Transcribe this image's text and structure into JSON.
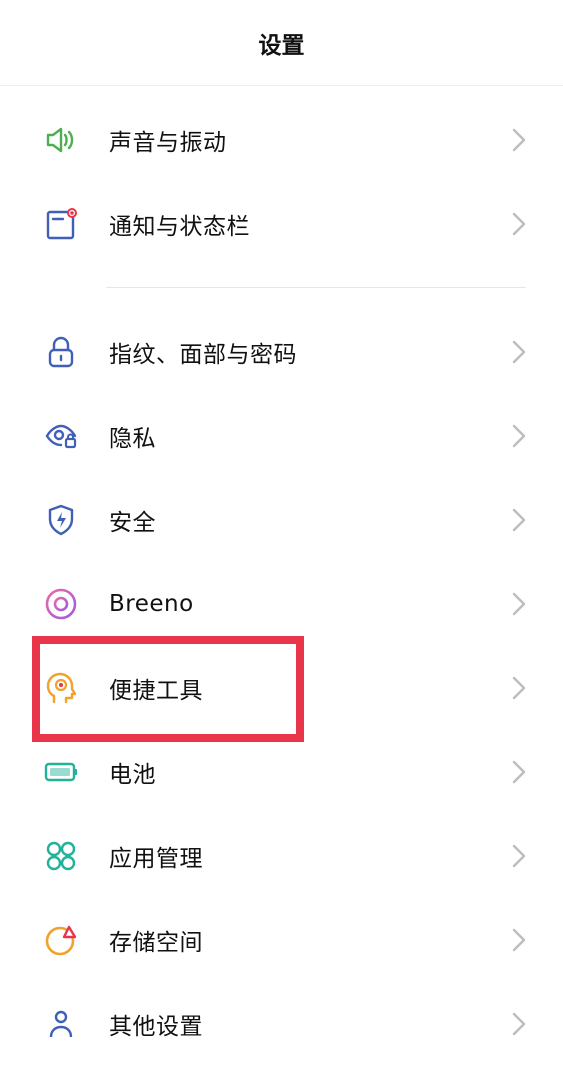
{
  "header": {
    "title": "设置"
  },
  "items": [
    {
      "label": "声音与振动",
      "icon": "speaker-icon"
    },
    {
      "label": "通知与状态栏",
      "icon": "notification-icon"
    },
    {
      "label": "指纹、面部与密码",
      "icon": "lock-icon"
    },
    {
      "label": "隐私",
      "icon": "eye-lock-icon"
    },
    {
      "label": "安全",
      "icon": "shield-icon"
    },
    {
      "label": "Breeno",
      "icon": "breeno-icon"
    },
    {
      "label": "便捷工具",
      "icon": "head-icon"
    },
    {
      "label": "电池",
      "icon": "battery-icon"
    },
    {
      "label": "应用管理",
      "icon": "apps-icon"
    },
    {
      "label": "存储空间",
      "icon": "storage-icon"
    },
    {
      "label": "其他设置",
      "icon": "person-icon"
    }
  ],
  "colors": {
    "green": "#4caf50",
    "blue": "#3f5fb8",
    "pink": "#d04aa0",
    "orange": "#f2a12b",
    "teal": "#20b29a",
    "highlight": "#e8354a"
  }
}
